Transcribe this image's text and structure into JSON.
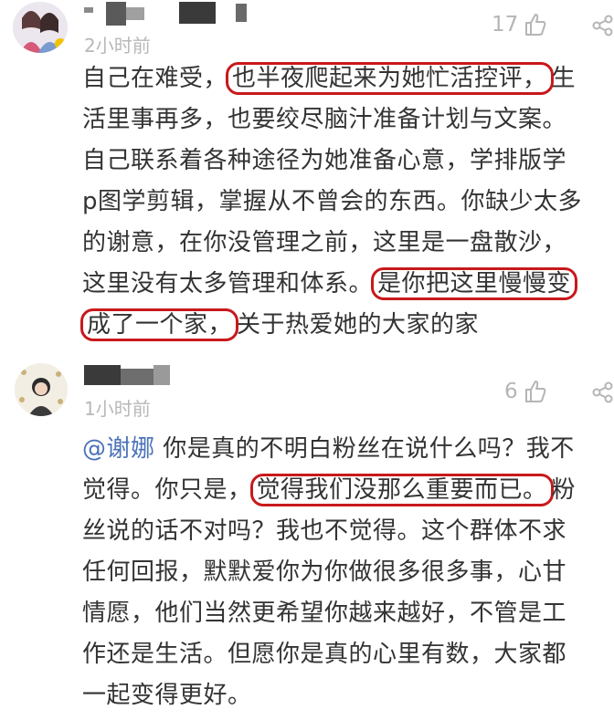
{
  "comments": [
    {
      "time": "2小时前",
      "likes": "17",
      "lines": [
        [
          {
            "t": "自己在难受，"
          },
          {
            "t": "也半夜爬起来为她忙活控评，",
            "hl": true
          },
          {
            "t": "生"
          }
        ],
        [
          {
            "t": "活里事再多，也要绞尽脑汁准备计划与文案。"
          }
        ],
        [
          {
            "t": "自己联系着各种途径为她准备心意，学排版学"
          }
        ],
        [
          {
            "t": "p图学剪辑，掌握从不曾会的东西。你缺少太多"
          }
        ],
        [
          {
            "t": "的谢意，在你没管理之前，这里是一盘散沙，"
          }
        ],
        [
          {
            "t": "这里没有太多管理和体系。"
          },
          {
            "t": "是你把这里慢慢变",
            "hl": true
          }
        ],
        [
          {
            "t": "成了一个家，",
            "hl": true
          },
          {
            "t": "关于热爱她的大家的家"
          }
        ]
      ]
    },
    {
      "time": "1小时前",
      "likes": "6",
      "lines": [
        [
          {
            "t": "@谢娜",
            "mention": true
          },
          {
            "t": " 你是真的不明白粉丝在说什么吗？我不"
          }
        ],
        [
          {
            "t": "觉得。你只是，"
          },
          {
            "t": "觉得我们没那么重要而已。",
            "hl": true
          },
          {
            "t": "粉"
          }
        ],
        [
          {
            "t": "丝说的话不对吗？我也不觉得。这个群体不求"
          }
        ],
        [
          {
            "t": "任何回报，默默爱你为你做很多很多事，心甘"
          }
        ],
        [
          {
            "t": "情愿，他们当然更希望你越来越好，不管是工"
          }
        ],
        [
          {
            "t": "作还是生活。但愿你是真的心里有数，大家都"
          }
        ],
        [
          {
            "t": "一起变得更好。"
          }
        ]
      ]
    }
  ],
  "colors": {
    "highlight_border": "#c8191c",
    "mention": "#4a72b8",
    "meta": "#b5b5b5"
  },
  "icons": {
    "like": "thumbs-up-icon",
    "share": "share-icon"
  }
}
